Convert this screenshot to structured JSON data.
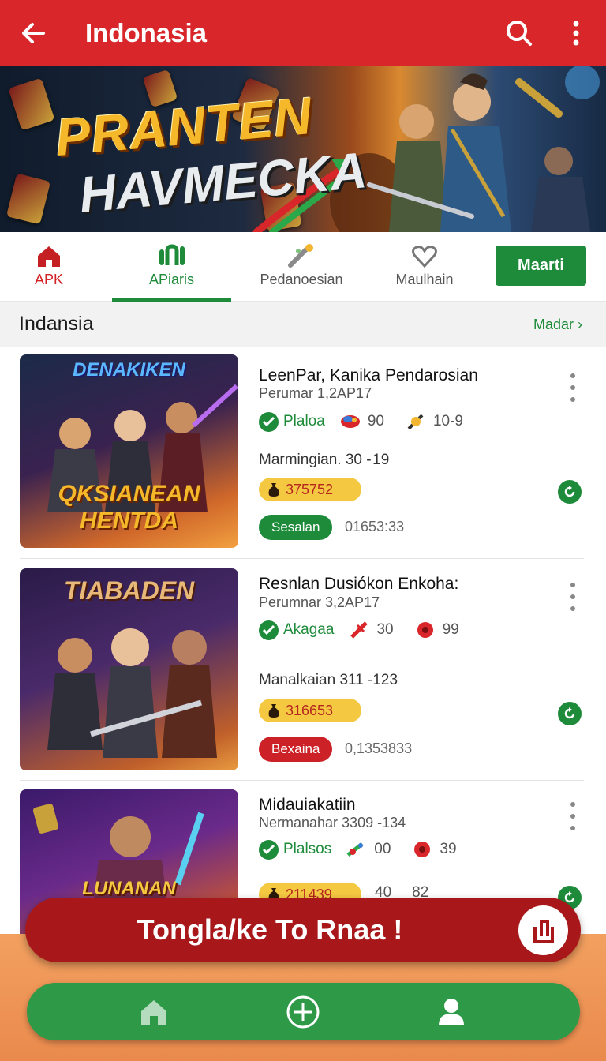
{
  "appbar": {
    "title": "Indonasia",
    "icons": [
      "back-arrow-icon",
      "search-icon",
      "more-vert-icon"
    ]
  },
  "hero": {
    "title": "PRANTEN",
    "subtitle": "HAVMECKA"
  },
  "tabs": [
    {
      "label": "APK",
      "icon": "home-icon"
    },
    {
      "label": "APiaris",
      "icon": "apps-icon"
    },
    {
      "label": "Pedanoesian",
      "icon": "wand-icon"
    },
    {
      "label": "Maulhain",
      "icon": "heart-icon"
    }
  ],
  "tab_button": {
    "label": "Maarti"
  },
  "section": {
    "title": "Indansia",
    "more": "Madar"
  },
  "items": [
    {
      "thumb_title": "DENAKIKEN",
      "thumb_sub": "QKSIANEAN HENTDA",
      "title": "LeenPar, Kanika Pendarosian",
      "subtitle": "Perumar 1,2AP17",
      "verified_label": "Plaloa",
      "stat1": "90",
      "stat2": "10-9",
      "date": "Marmingian. 30 - 19",
      "price": "375752",
      "pill": "Sesalan",
      "pill_color": "#1e8b3a",
      "timestamp": "01653:33"
    },
    {
      "thumb_title": "TIABADEN",
      "thumb_sub": "",
      "title": "Resnlan Dusiókon Enkoha:",
      "subtitle": "Perumnar 3,2AP17",
      "verified_label": "Akagaa",
      "stat1": "30",
      "stat2": "99",
      "date": "Manalkaian 311 -123",
      "price": "316653",
      "pill": "Bexaina",
      "pill_color": "#cc2227",
      "timestamp": "0,1353833"
    },
    {
      "thumb_title": "",
      "thumb_sub": "LUNANAN",
      "title": "Midauiakatiin",
      "subtitle": "Nermanahar 3309 -134",
      "verified_label": "Plalsos",
      "stat1": "00",
      "stat2": "39",
      "price": "211439",
      "price_stat1": "40",
      "price_stat2": "82"
    }
  ],
  "cta": {
    "label": "Tongla/ke To Rnaa !",
    "icon": "share-icon"
  },
  "bottom_nav": [
    "home-icon",
    "add-circle-icon",
    "profile-icon"
  ],
  "colors": {
    "primary_red": "#d8262a",
    "primary_green": "#1e8b3a",
    "price_yellow": "#f5c842",
    "cta_red": "#a8181b"
  }
}
